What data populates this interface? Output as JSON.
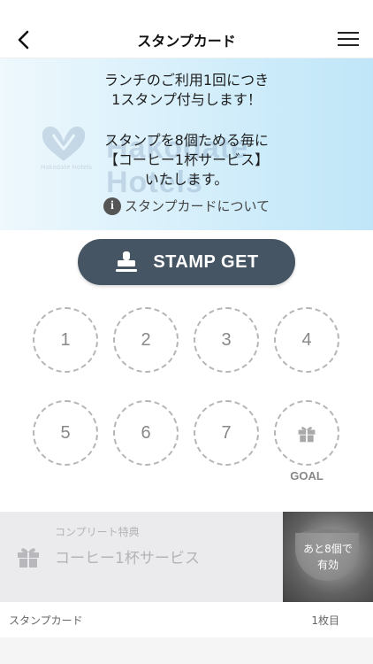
{
  "nav": {
    "title": "スタンプカード"
  },
  "hero": {
    "line1": "ランチのご利用1回につき",
    "line2": "1スタンプ付与します！",
    "line3": "スタンプを8個ためる毎に",
    "line4": "【コーヒー1杯サービス】",
    "line5": "いたします。",
    "about_link": "スタンプカードについて",
    "watermark_brand": "Hakodate Hotels",
    "watermark_logo_text": "Hakodate Hotels"
  },
  "stamp_button": {
    "label": "STAMP GET"
  },
  "slots": [
    "1",
    "2",
    "3",
    "4",
    "5",
    "6",
    "7"
  ],
  "goal_label": "GOAL",
  "complete": {
    "label": "コンプリート特典",
    "item": "コーヒー1杯サービス",
    "overlay_line1": "あと8個で",
    "overlay_line2": "有効"
  },
  "footer": {
    "left": "スタンプカード",
    "right": "1枚目"
  },
  "colors": {
    "stamp_button_bg": "#465563",
    "hero_gradient_end": "#bfe6f8"
  }
}
